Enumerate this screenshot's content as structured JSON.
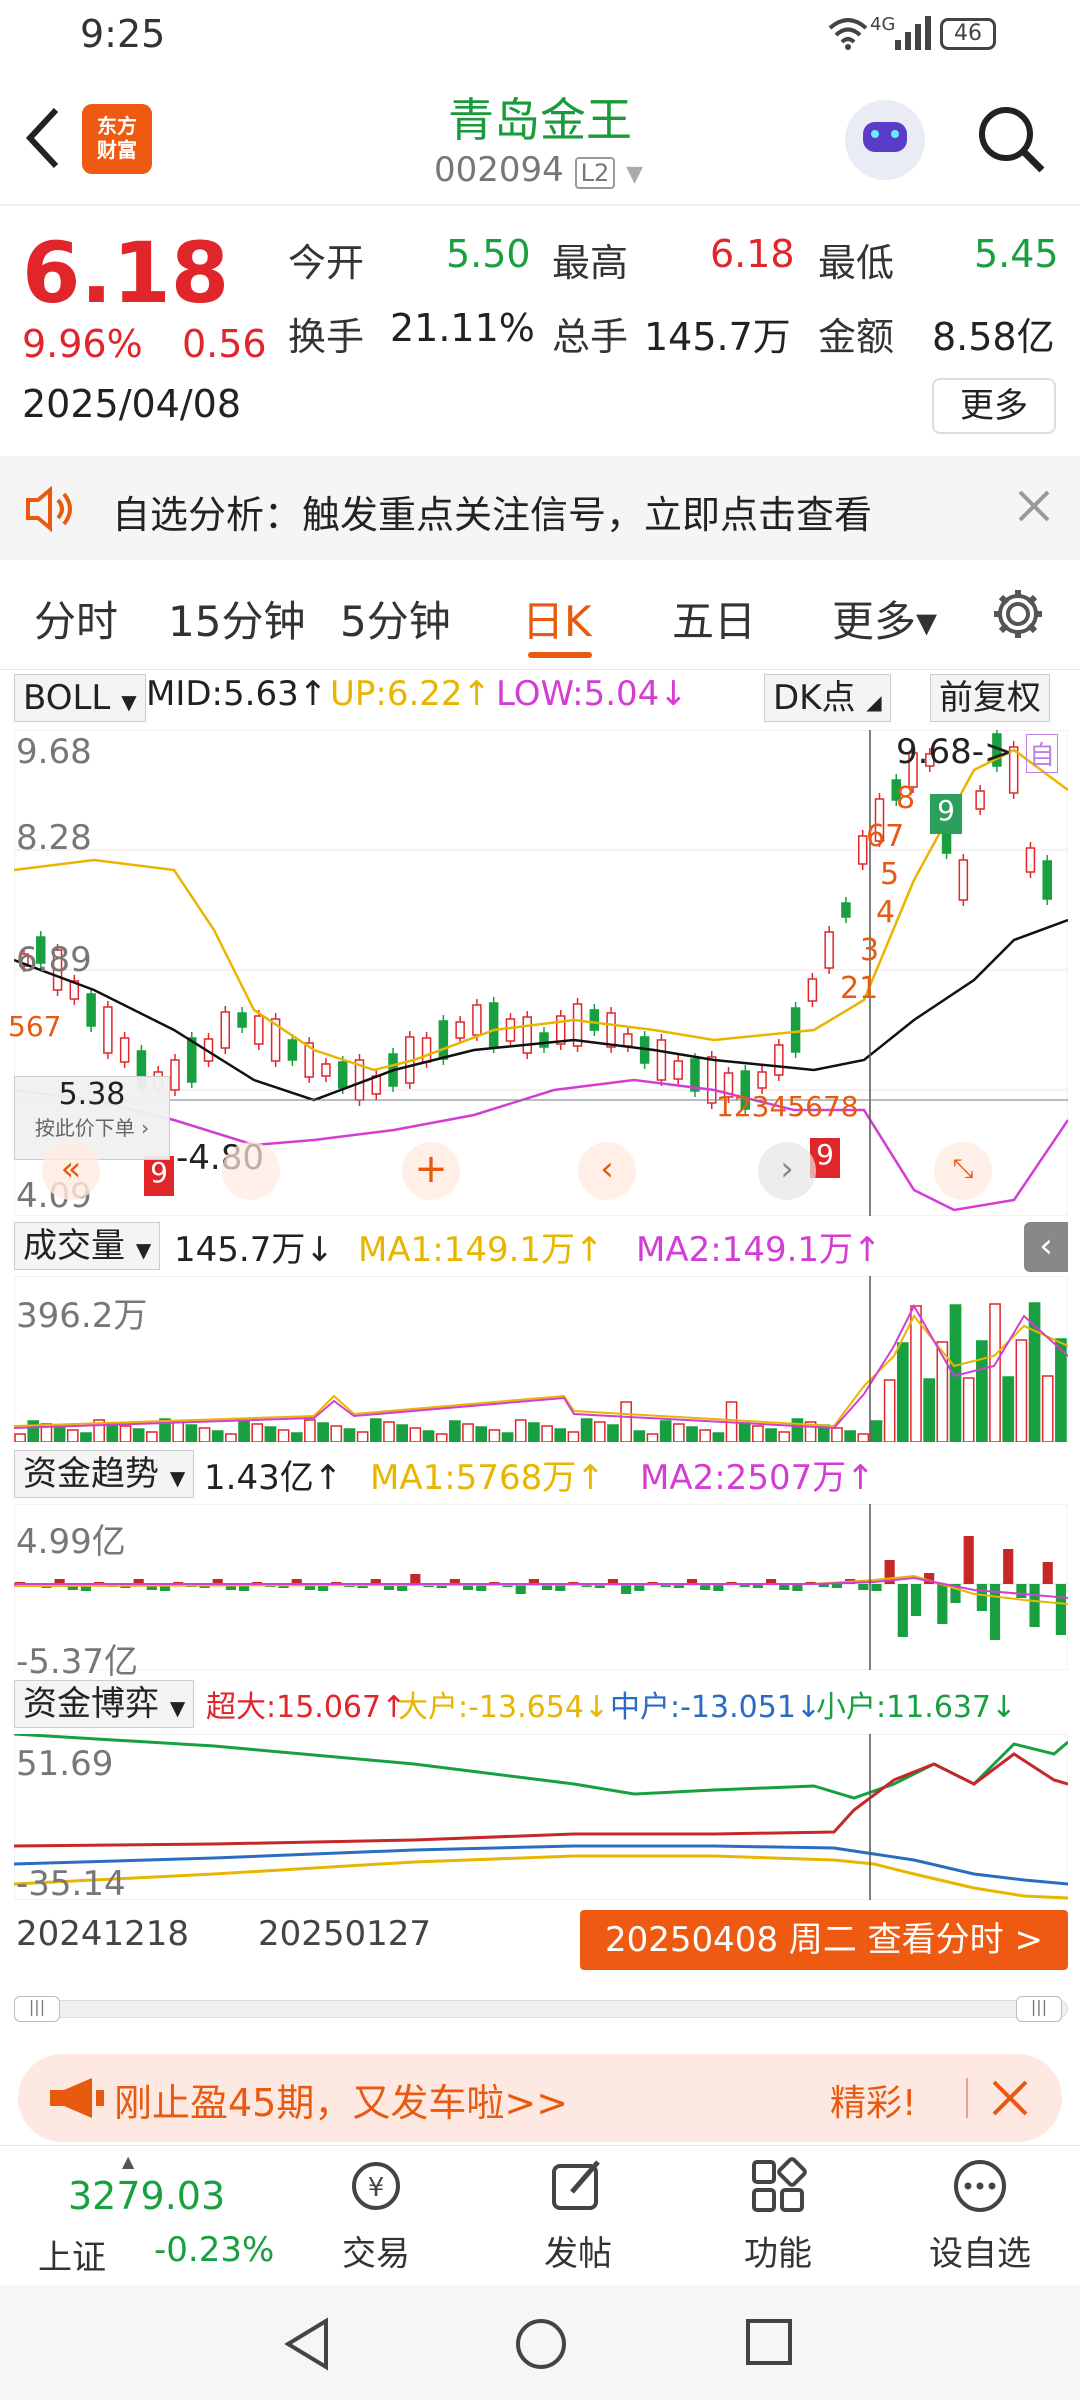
{
  "status": {
    "time": "9:25",
    "net": "4G",
    "battery": "46"
  },
  "header": {
    "logo_line1": "东方",
    "logo_line2": "财富",
    "title": "青岛金王",
    "code": "002094",
    "level": "L2"
  },
  "quote": {
    "price": "6.18",
    "change_pct": "9.96%",
    "change": "0.56",
    "date": "2025/04/08",
    "open_label": "今开",
    "open": "5.50",
    "high_label": "最高",
    "high": "6.18",
    "low_label": "最低",
    "low": "5.45",
    "turnover_label": "换手",
    "turnover": "21.11%",
    "volume_label": "总手",
    "volume": "145.7万",
    "amount_label": "金额",
    "amount": "8.58亿",
    "more_button": "更多"
  },
  "banner": {
    "text": "自选分析：触发重点关注信号，立即点击查看"
  },
  "tabs": [
    "分时",
    "15分钟",
    "5分钟",
    "日K",
    "五日",
    "更多▾"
  ],
  "kline": {
    "indicator": "BOLL",
    "mid": "MID:5.63",
    "up": "UP:6.22",
    "low": "LOW:5.04",
    "dk_button": "DK点",
    "adjust_button": "前复权",
    "y_labels": [
      "9.68",
      "8.28",
      "6.89",
      "4.09"
    ],
    "max_label": "9.68->",
    "self_tag": "自",
    "cursor_price": "5.38",
    "cursor_hint": "按此价下单",
    "min_label": "-4.80",
    "seq_left": [
      "5",
      "6",
      "7",
      "8",
      "7",
      "9"
    ],
    "seq_mid": [
      "1",
      "2",
      "3",
      "4",
      "5",
      "6",
      "7",
      "8",
      "9"
    ],
    "seq_right": [
      "1",
      "2",
      "3",
      "4",
      "5",
      "6",
      "7",
      "8",
      "9"
    ]
  },
  "volume": {
    "label": "成交量",
    "value": "145.7万",
    "ma1": "MA1:149.1万",
    "ma2": "MA2:149.1万",
    "y_max": "396.2万"
  },
  "capital_trend": {
    "label": "资金趋势",
    "value": "1.43亿",
    "ma1": "MA1:5768万",
    "ma2": "MA2:2507万",
    "y_max": "4.99亿",
    "y_min": "-5.37亿"
  },
  "capital_game": {
    "label": "资金博弈",
    "super": "超大:15.067",
    "large": "大户:-13.654",
    "mid": "中户:-13.051",
    "small": "小户:11.637",
    "y_max": "51.69",
    "y_min": "-35.14"
  },
  "dates": {
    "start": "20241218",
    "mid": "20250127",
    "selected": "20250408 周二 查看分时 >"
  },
  "promo": {
    "text": "刚止盈45期，又发车啦>>",
    "tag": "精彩!"
  },
  "bottom_nav": {
    "index_value": "3279.03",
    "index_name": "上证",
    "index_change": "-0.23%",
    "items": [
      "交易",
      "发帖",
      "功能",
      "设自选"
    ]
  },
  "colors": {
    "up": "#e0262a",
    "down": "#18a040",
    "accent": "#e85a10",
    "boll_up": "#e8b500",
    "boll_low": "#d43dd4"
  }
}
